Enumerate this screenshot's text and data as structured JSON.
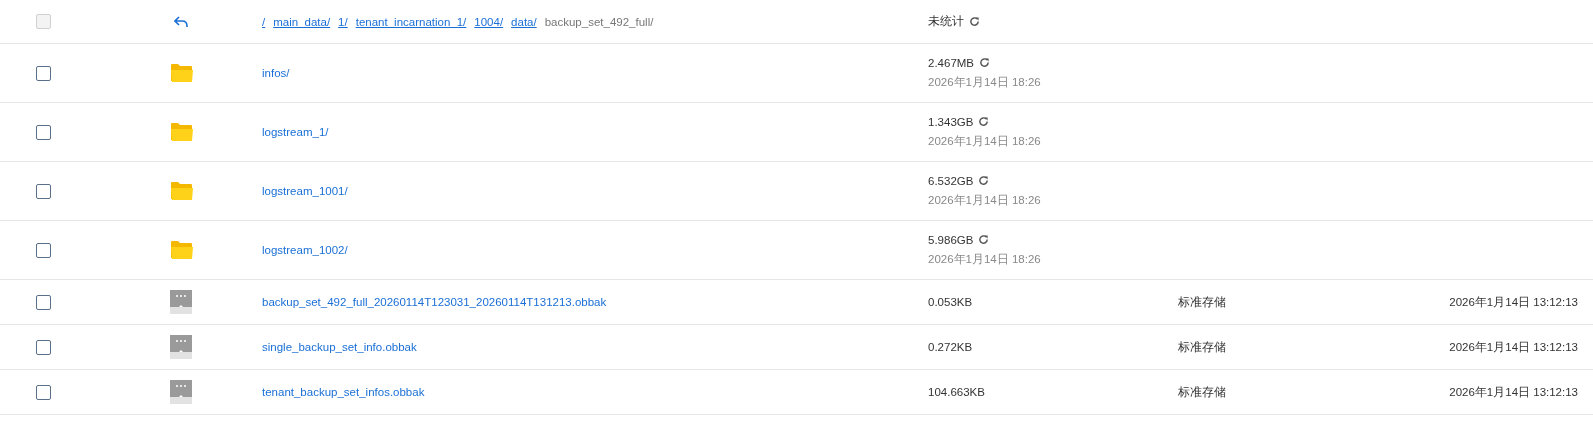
{
  "header": {
    "checkbox_disabled": true,
    "breadcrumbs": [
      {
        "label": "/",
        "link": true
      },
      {
        "label": "main_data/",
        "link": true
      },
      {
        "label": "1/",
        "link": true
      },
      {
        "label": "tenant_incarnation_1/",
        "link": true
      },
      {
        "label": "1004/",
        "link": true
      },
      {
        "label": "data/",
        "link": true
      },
      {
        "label": "backup_set_492_full/",
        "link": false
      }
    ],
    "size": "未统计"
  },
  "rows": [
    {
      "kind": "folder",
      "checked": false,
      "name": "infos/",
      "size": "2.467MB",
      "modified": "2026年1月14日 18:26"
    },
    {
      "kind": "folder",
      "checked": false,
      "name": "logstream_1/",
      "size": "1.343GB",
      "modified": "2026年1月14日 18:26"
    },
    {
      "kind": "folder",
      "checked": false,
      "name": "logstream_1001/",
      "size": "6.532GB",
      "modified": "2026年1月14日 18:26"
    },
    {
      "kind": "folder",
      "checked": false,
      "name": "logstream_1002/",
      "size": "5.986GB",
      "modified": "2026年1月14日 18:26"
    },
    {
      "kind": "file",
      "checked": false,
      "name": "backup_set_492_full_20260114T123031_20260114T131213.obbak",
      "size": "0.053KB",
      "storage": "标准存储",
      "modified": "2026年1月14日 13:12:13"
    },
    {
      "kind": "file",
      "checked": false,
      "name": "single_backup_set_info.obbak",
      "size": "0.272KB",
      "storage": "标准存储",
      "modified": "2026年1月14日 13:12:13"
    },
    {
      "kind": "file",
      "checked": false,
      "name": "tenant_backup_set_infos.obbak",
      "size": "104.663KB",
      "storage": "标准存储",
      "modified": "2026年1月14日 13:12:13"
    }
  ]
}
